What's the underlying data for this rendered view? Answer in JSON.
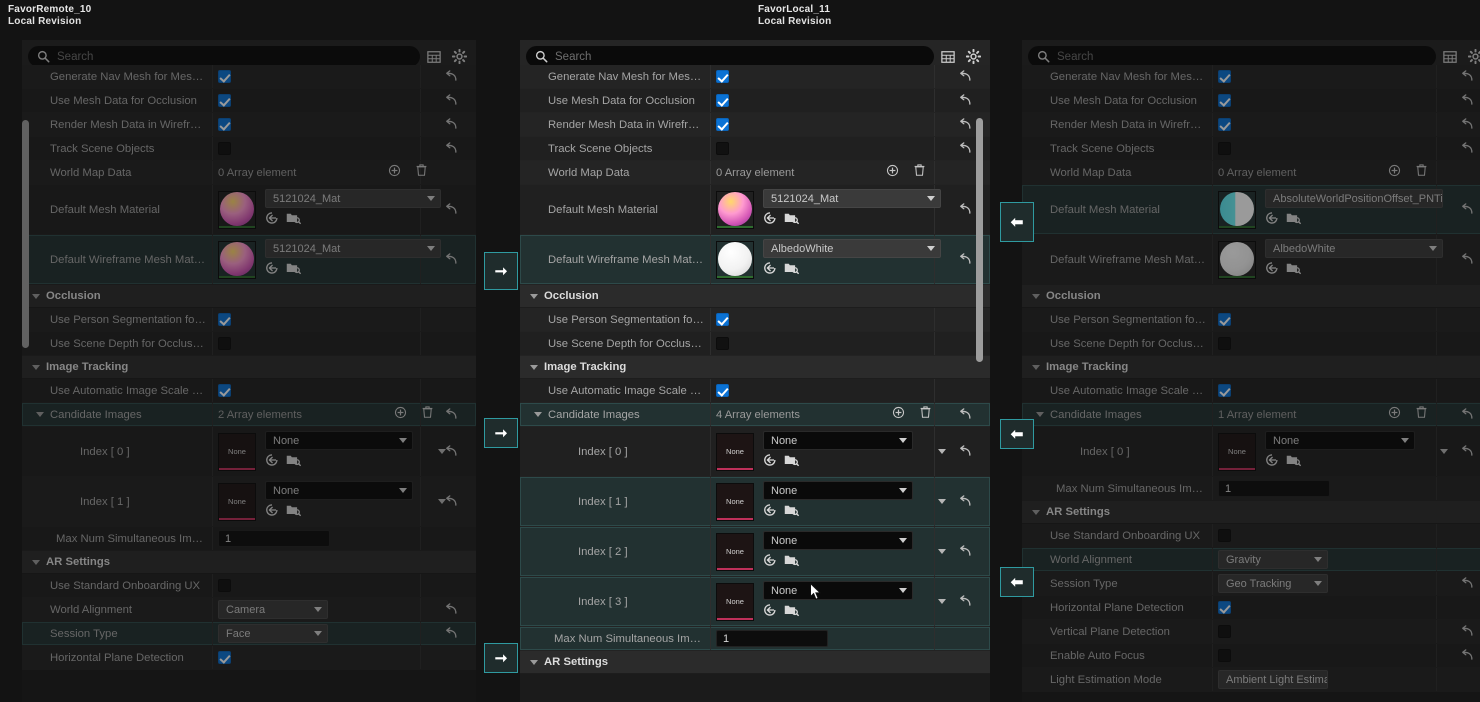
{
  "panels": {
    "left": {
      "title": "FavorRemote_10",
      "subtitle": "Local Revision",
      "search_placeholder": "Search",
      "rows": [
        {
          "label": "Generate Nav Mesh for Mesh...",
          "type": "checkbox",
          "checked": true,
          "revert": true
        },
        {
          "label": "Use Mesh Data for Occlusion",
          "type": "checkbox",
          "checked": true,
          "revert": true
        },
        {
          "label": "Render Mesh Data in Wireframe",
          "type": "checkbox",
          "checked": true,
          "revert": true
        },
        {
          "label": "Track Scene Objects",
          "type": "checkbox",
          "checked": false,
          "revert": true
        },
        {
          "label": "World Map Data",
          "type": "array",
          "value": "0 Array element",
          "revert": false
        },
        {
          "label": "Default Mesh Material",
          "type": "material",
          "value": "5121024_Mat",
          "thumb": "magenta",
          "revert": true
        },
        {
          "label": "Default Wireframe Mesh Mate...",
          "type": "material",
          "value": "5121024_Mat",
          "thumb": "magenta",
          "revert": true,
          "highlight": true
        },
        {
          "label": "Occlusion",
          "type": "category"
        },
        {
          "label": "Use Person Segmentation for...",
          "type": "checkbox",
          "checked": true
        },
        {
          "label": "Use Scene Depth for Occlusion",
          "type": "checkbox",
          "checked": false
        },
        {
          "label": "Image Tracking",
          "type": "category"
        },
        {
          "label": "Use Automatic Image Scale E...",
          "type": "checkbox",
          "checked": true
        },
        {
          "label": "Candidate Images",
          "type": "array",
          "value": "2 Array elements",
          "revert": true,
          "highlight": true,
          "expandable": true
        },
        {
          "label": "Index [ 0 ]",
          "type": "asset",
          "value": "None",
          "revert": true
        },
        {
          "label": "Index [ 1 ]",
          "type": "asset",
          "value": "None",
          "revert": true
        },
        {
          "label": "Max Num Simultaneous Imag...",
          "type": "number",
          "value": "1"
        },
        {
          "label": "AR Settings",
          "type": "category"
        },
        {
          "label": "Use Standard Onboarding UX",
          "type": "checkbox",
          "checked": false
        },
        {
          "label": "World Alignment",
          "type": "enum",
          "value": "Camera",
          "revert": true
        },
        {
          "label": "Session Type",
          "type": "enum",
          "value": "Face",
          "revert": true,
          "highlight": true
        },
        {
          "label": "Horizontal Plane Detection",
          "type": "checkbox",
          "checked": true
        }
      ]
    },
    "middle": {
      "title": "FavorLocal_11",
      "subtitle": "Local Revision",
      "search_placeholder": "Search",
      "rows": [
        {
          "label": "Generate Nav Mesh for Mesh D...",
          "type": "checkbox",
          "checked": true,
          "revert": true
        },
        {
          "label": "Use Mesh Data for Occlusion",
          "type": "checkbox",
          "checked": true,
          "revert": true
        },
        {
          "label": "Render Mesh Data in Wireframe",
          "type": "checkbox",
          "checked": true,
          "revert": true
        },
        {
          "label": "Track Scene Objects",
          "type": "checkbox",
          "checked": false,
          "revert": true
        },
        {
          "label": "World Map Data",
          "type": "array",
          "value": "0 Array element"
        },
        {
          "label": "Default Mesh Material",
          "type": "material",
          "value": "5121024_Mat",
          "thumb": "magenta",
          "revert": true
        },
        {
          "label": "Default Wireframe Mesh Materi...",
          "type": "material",
          "value": "AlbedoWhite",
          "thumb": "white",
          "revert": true,
          "highlight": true
        },
        {
          "label": "Occlusion",
          "type": "category"
        },
        {
          "label": "Use Person Segmentation for O...",
          "type": "checkbox",
          "checked": true
        },
        {
          "label": "Use Scene Depth for Occlusion",
          "type": "checkbox",
          "checked": false
        },
        {
          "label": "Image Tracking",
          "type": "category"
        },
        {
          "label": "Use Automatic Image Scale Es...",
          "type": "checkbox",
          "checked": true
        },
        {
          "label": "Candidate Images",
          "type": "array",
          "value": "4 Array elements",
          "revert": true,
          "highlight": true,
          "expandable": true
        },
        {
          "label": "Index [ 0 ]",
          "type": "asset",
          "value": "None",
          "revert": true
        },
        {
          "label": "Index [ 1 ]",
          "type": "asset",
          "value": "None",
          "revert": true,
          "highlight": true
        },
        {
          "label": "Index [ 2 ]",
          "type": "asset",
          "value": "None",
          "revert": true,
          "highlight": true
        },
        {
          "label": "Index [ 3 ]",
          "type": "asset",
          "value": "None",
          "revert": true,
          "highlight": true
        },
        {
          "label": "Max Num Simultaneous Image...",
          "type": "number",
          "value": "1",
          "highlight": true
        },
        {
          "label": "AR Settings",
          "type": "category"
        }
      ]
    },
    "right": {
      "search_placeholder": "Search",
      "rows": [
        {
          "label": "Generate Nav Mesh for Mesh D...",
          "type": "checkbox",
          "checked": true,
          "revert": true
        },
        {
          "label": "Use Mesh Data for Occlusion",
          "type": "checkbox",
          "checked": true,
          "revert": true
        },
        {
          "label": "Render Mesh Data in Wireframe",
          "type": "checkbox",
          "checked": true,
          "revert": true
        },
        {
          "label": "Track Scene Objects",
          "type": "checkbox",
          "checked": false,
          "revert": true
        },
        {
          "label": "World Map Data",
          "type": "array",
          "value": "0 Array element"
        },
        {
          "label": "Default Mesh Material",
          "type": "material",
          "value": "AbsoluteWorldPositionOffset_PNTi",
          "thumb": "cyan",
          "revert": true,
          "highlight": true
        },
        {
          "label": "Default Wireframe Mesh Materi...",
          "type": "material",
          "value": "AlbedoWhite",
          "thumb": "white",
          "revert": true
        },
        {
          "label": "Occlusion",
          "type": "category"
        },
        {
          "label": "Use Person Segmentation for O...",
          "type": "checkbox",
          "checked": true
        },
        {
          "label": "Use Scene Depth for Occlusion",
          "type": "checkbox",
          "checked": false
        },
        {
          "label": "Image Tracking",
          "type": "category"
        },
        {
          "label": "Use Automatic Image Scale Es...",
          "type": "checkbox",
          "checked": true
        },
        {
          "label": "Candidate Images",
          "type": "array",
          "value": "1 Array element",
          "revert": true,
          "highlight": true,
          "expandable": true
        },
        {
          "label": "Index [ 0 ]",
          "type": "asset",
          "value": "None",
          "revert": true
        },
        {
          "label": "Max Num Simultaneous Image...",
          "type": "number",
          "value": "1"
        },
        {
          "label": "AR Settings",
          "type": "category"
        },
        {
          "label": "Use Standard Onboarding UX",
          "type": "checkbox",
          "checked": false
        },
        {
          "label": "World Alignment",
          "type": "enum",
          "value": "Gravity",
          "highlight": true
        },
        {
          "label": "Session Type",
          "type": "enum",
          "value": "Geo Tracking",
          "revert": true
        },
        {
          "label": "Horizontal Plane Detection",
          "type": "checkbox",
          "checked": true
        },
        {
          "label": "Vertical Plane Detection",
          "type": "checkbox",
          "checked": false,
          "revert": true
        },
        {
          "label": "Enable Auto Focus",
          "type": "checkbox",
          "checked": false,
          "revert": true
        },
        {
          "label": "Light Estimation Mode",
          "type": "enum",
          "value": "Ambient Light Estimate M"
        }
      ]
    }
  },
  "icons": {
    "search": "search-icon",
    "columns": "columns-icon",
    "settings": "gear-icon",
    "add": "add-element-icon",
    "delete": "delete-element-icon",
    "revert": "revert-arrow-icon",
    "browse": "browse-asset-icon",
    "use_selected": "use-selected-asset-icon",
    "arrow_right": "merge-right-arrow-icon",
    "arrow_left": "merge-left-arrow-icon"
  },
  "colors": {
    "accent_teal": "#2f9aa0",
    "checkbox_blue": "#0b72d4",
    "highlight_row": "#223131",
    "panel_bg": "#1b1b1b",
    "row_bg": "#242424"
  },
  "labels": {
    "none": "None",
    "array_add": "+",
    "array_delete": "trash"
  }
}
